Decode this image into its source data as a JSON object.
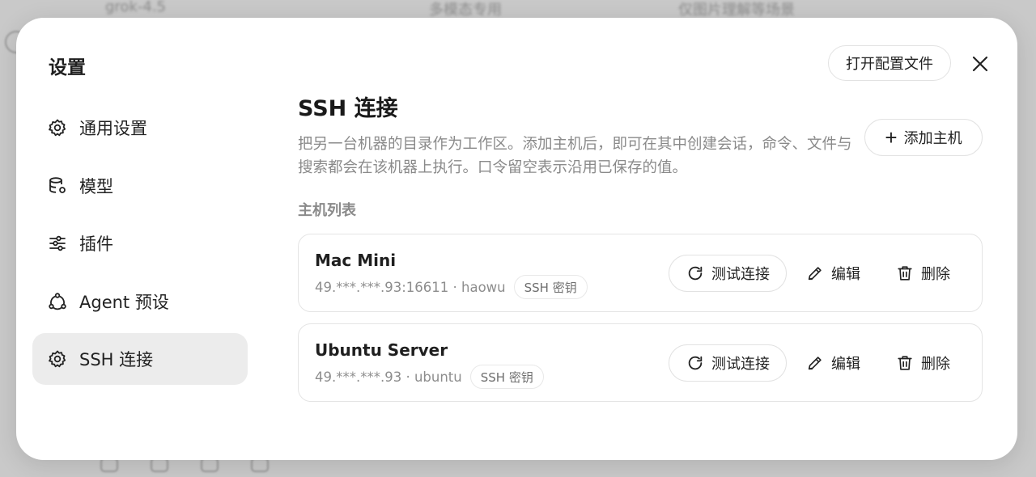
{
  "background": {
    "row": [
      "grok-4.5",
      "多模态专用",
      "仅图片理解等场景"
    ]
  },
  "modal": {
    "title": "设置",
    "open_config_label": "打开配置文件"
  },
  "sidebar": {
    "items": [
      {
        "label": "通用设置",
        "icon": "gear-icon",
        "active": false
      },
      {
        "label": "模型",
        "icon": "database-icon",
        "active": false
      },
      {
        "label": "插件",
        "icon": "sliders-icon",
        "active": false
      },
      {
        "label": "Agent 预设",
        "icon": "agent-icon",
        "active": false
      },
      {
        "label": "SSH 连接",
        "icon": "gear-icon",
        "active": true
      }
    ]
  },
  "main": {
    "title": "SSH 连接",
    "description": "把另一台机器的目录作为工作区。添加主机后，即可在其中创建会话，命令、文件与搜索都会在该机器上执行。口令留空表示沿用已保存的值。",
    "add_host_label": "添加主机",
    "list_label": "主机列表",
    "hosts": [
      {
        "name": "Mac Mini",
        "meta": "49.***.***.93:16611 · haowu",
        "auth": "SSH 密钥"
      },
      {
        "name": "Ubuntu Server",
        "meta": "49.***.***.93 · ubuntu",
        "auth": "SSH 密钥"
      }
    ],
    "actions": {
      "test": "测试连接",
      "edit": "编辑",
      "delete": "删除"
    }
  },
  "colors": {
    "active_bg": "#ececec",
    "border": "#e2e2e2",
    "muted_text": "#8a8a8a"
  }
}
